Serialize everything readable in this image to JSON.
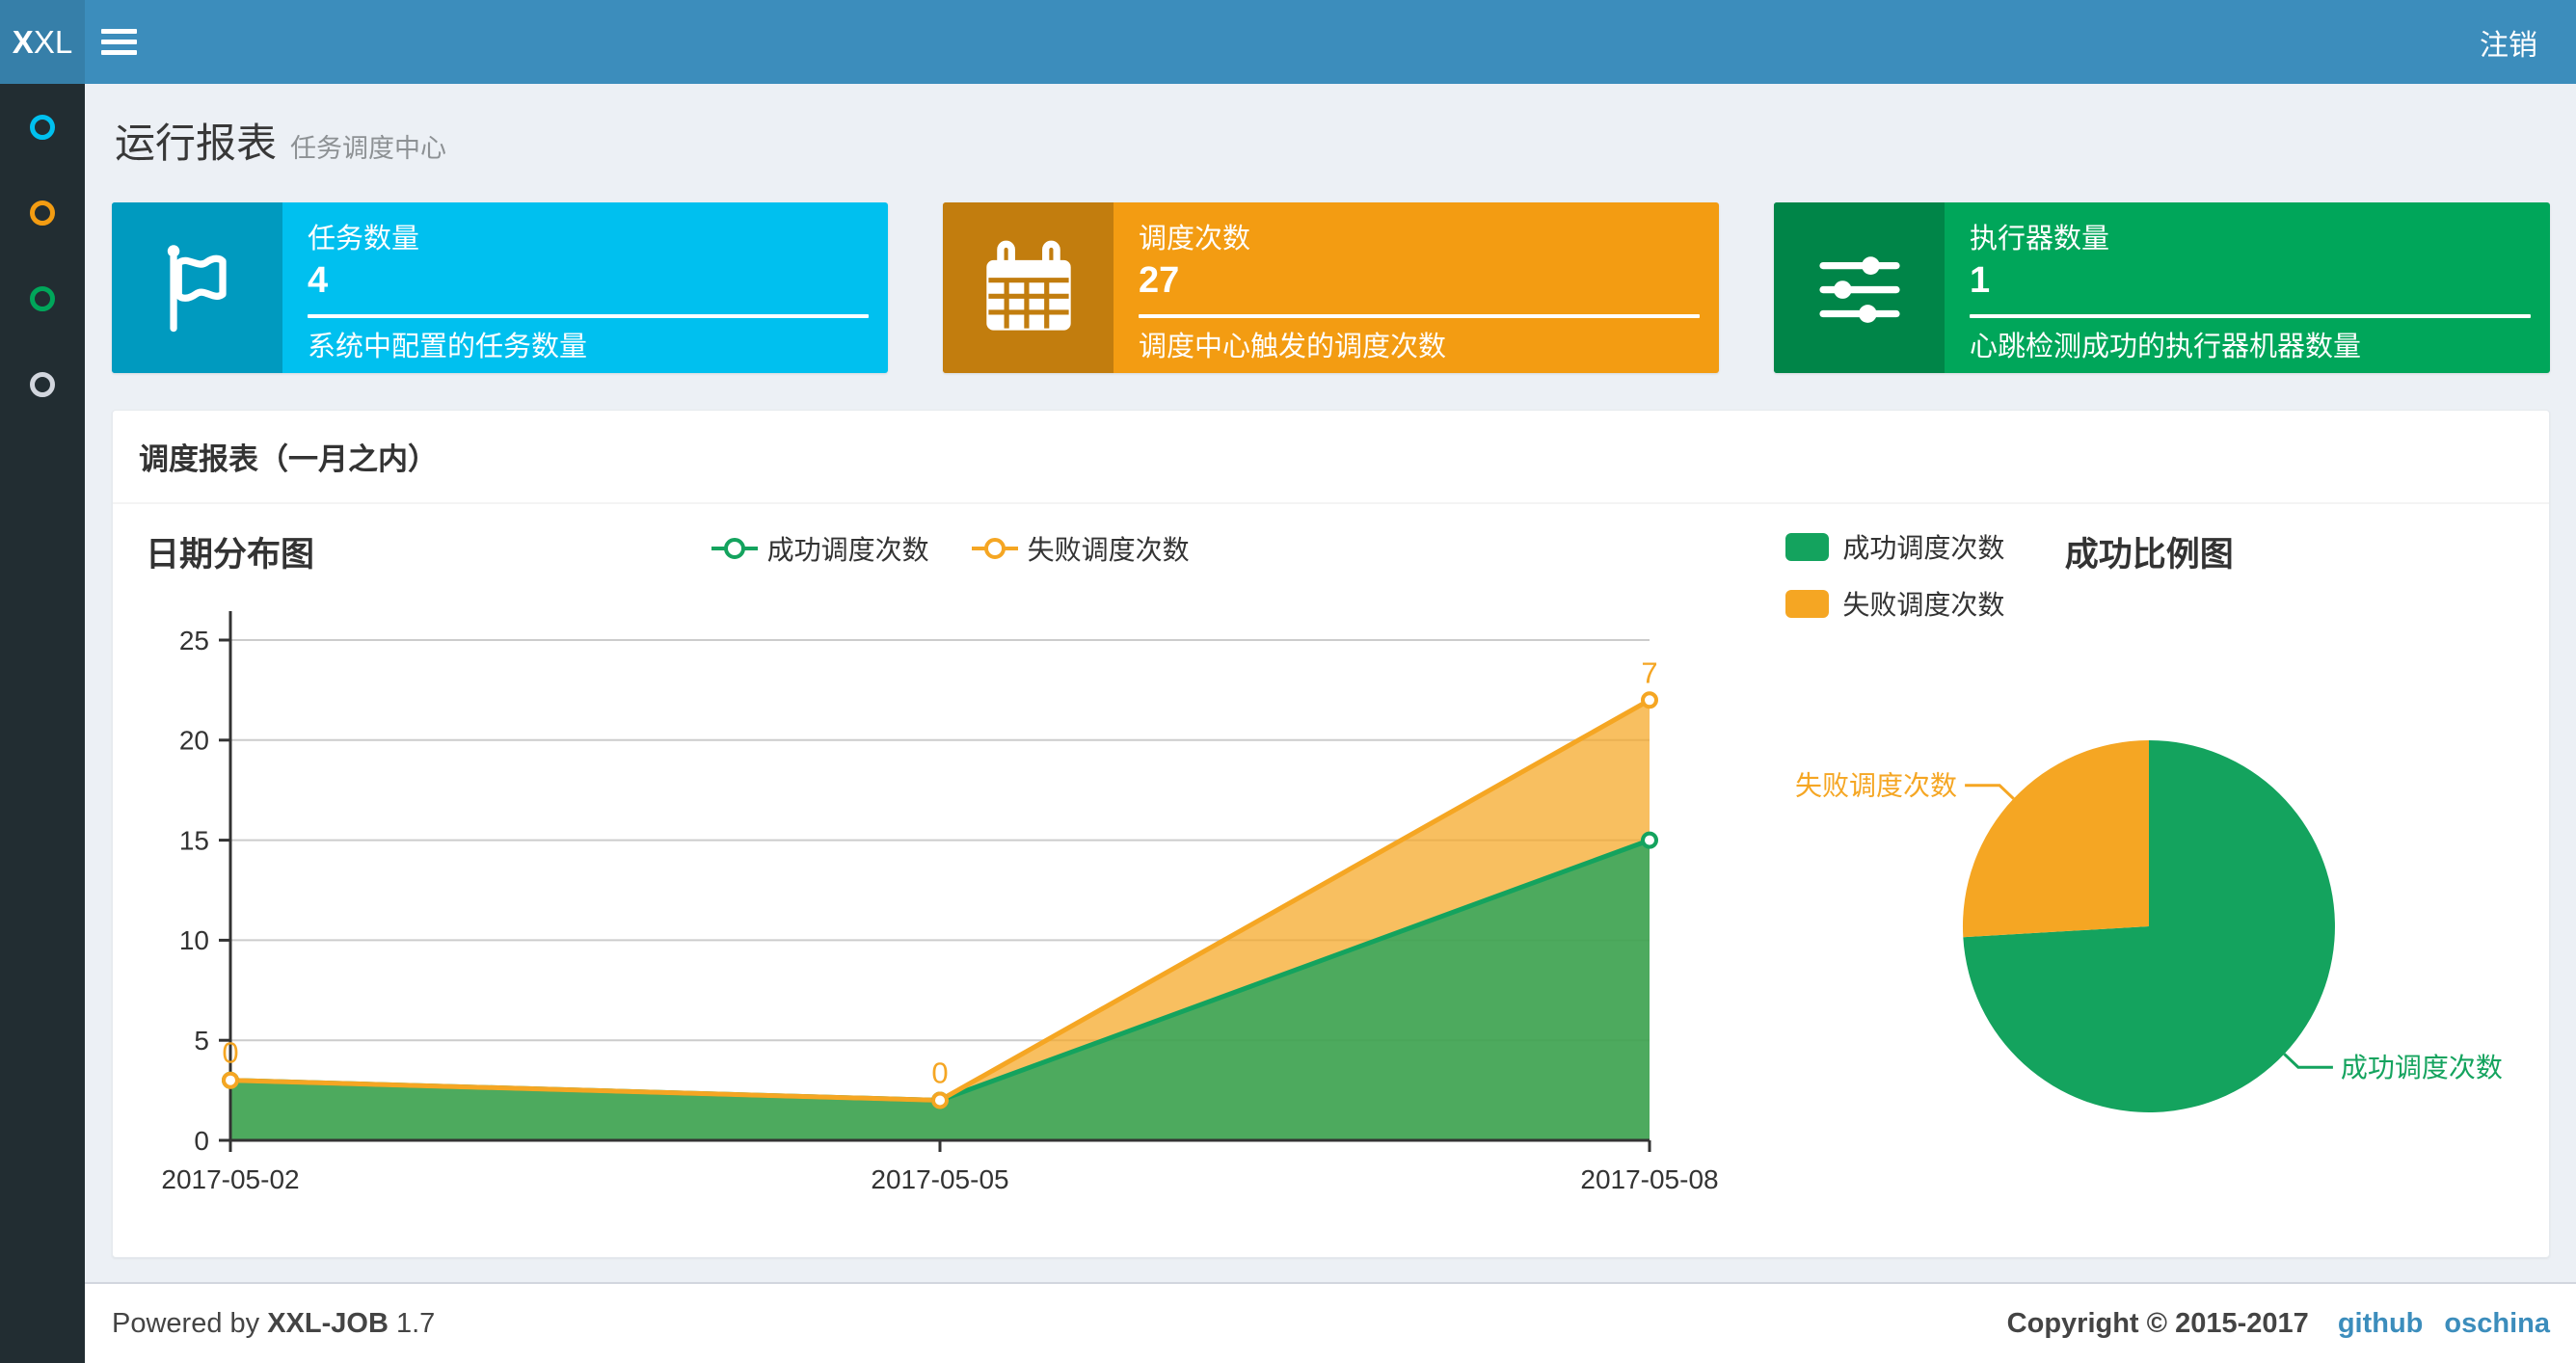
{
  "navbar": {
    "logo_bold": "X",
    "logo_rest": "XL",
    "logout_label": "注销",
    "color": "#3c8dbc",
    "logo_color": "#367fa9"
  },
  "sidebar": {
    "color": "#222d32",
    "items": [
      {
        "label": "sidebar-item-1",
        "icon": "circle-icon",
        "color": "#00c0ef"
      },
      {
        "label": "sidebar-item-2",
        "icon": "circle-icon",
        "color": "#f39c12"
      },
      {
        "label": "sidebar-item-3",
        "icon": "circle-icon",
        "color": "#00a65a"
      },
      {
        "label": "sidebar-item-4",
        "icon": "circle-icon",
        "color": "#d2d6de"
      }
    ]
  },
  "page_header": {
    "title": "运行报表",
    "subtitle": "任务调度中心"
  },
  "stat_boxes": [
    {
      "label": "任务数量",
      "value": "4",
      "description": "系统中配置的任务数量",
      "color": "#00c0ef",
      "icon_bg": "#009abf",
      "icon": "flag-icon"
    },
    {
      "label": "调度次数",
      "value": "27",
      "description": "调度中心触发的调度次数",
      "color": "#f39c12",
      "icon_bg": "#c27d0e",
      "icon": "calendar-icon"
    },
    {
      "label": "执行器数量",
      "value": "1",
      "description": "心跳检测成功的执行器机器数量",
      "color": "#00a65a",
      "icon_bg": "#008548",
      "icon": "sliders-icon"
    }
  ],
  "panel": {
    "title": "调度报表（一月之内）"
  },
  "chart_data": [
    {
      "type": "area",
      "title": "日期分布图",
      "stacked": true,
      "grid": true,
      "legend_position": "top-center",
      "categories": [
        "2017-05-02",
        "2017-05-05",
        "2017-05-08"
      ],
      "series": [
        {
          "name": "成功调度次数",
          "color": "#14a35e",
          "values": [
            3,
            2,
            15
          ]
        },
        {
          "name": "失败调度次数",
          "color": "#f5a623",
          "values": [
            0,
            0,
            7
          ],
          "point_labels": [
            "0",
            "0",
            "7"
          ]
        }
      ],
      "xlabel": "",
      "ylabel": "",
      "ylim": [
        0,
        25
      ],
      "yticks": [
        0,
        5,
        10,
        15,
        20,
        25
      ]
    },
    {
      "type": "pie",
      "title": "成功比例图",
      "legend_position": "top-left",
      "slices": [
        {
          "name": "成功调度次数",
          "value": 20,
          "color": "#14a35e"
        },
        {
          "name": "失败调度次数",
          "value": 7,
          "color": "#f5a623"
        }
      ]
    }
  ],
  "footer": {
    "powered_prefix": "Powered by",
    "product": "XXL-JOB",
    "version": "1.7",
    "copyright": "Copyright © 2015-2017",
    "links": [
      "github",
      "oschina"
    ]
  }
}
